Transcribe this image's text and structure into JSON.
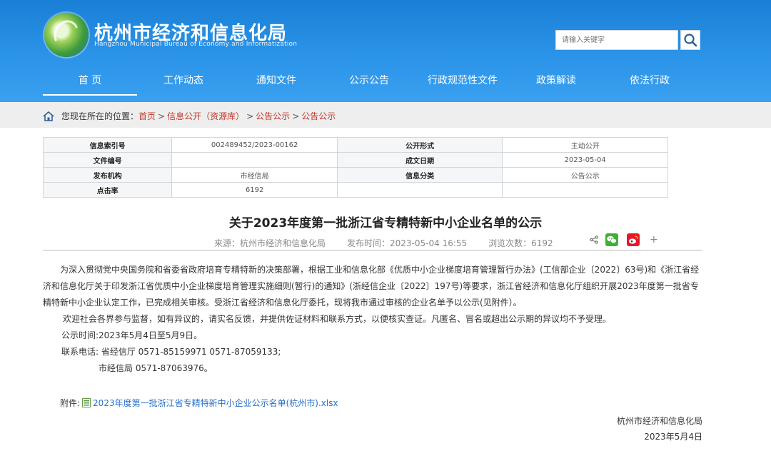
{
  "header": {
    "title": "杭州市经济和信息化局",
    "subtitle": "Hangzhou Municipal Bureau of Economy and Informatization",
    "search_placeholder": "请输入关键字"
  },
  "nav": [
    {
      "label": "首 页",
      "active": true
    },
    {
      "label": "工作动态"
    },
    {
      "label": "通知文件"
    },
    {
      "label": "公示公告"
    },
    {
      "label": "行政规范性文件"
    },
    {
      "label": "政策解读"
    },
    {
      "label": "依法行政"
    }
  ],
  "breadcrumb": {
    "prefix": "您现在所在的位置：",
    "items": [
      "首页",
      "信息公开（资源库）",
      "公告公示",
      "公告公示"
    ],
    "sep": ">"
  },
  "meta": {
    "rows": [
      [
        "信息索引号",
        "002489452/2023-00162",
        "公开形式",
        "主动公开"
      ],
      [
        "文件编号",
        "",
        "成文日期",
        "2023-05-04"
      ],
      [
        "发布机构",
        "市经信局",
        "信息分类",
        "公告公示"
      ],
      [
        "点击率",
        "6192",
        "",
        ""
      ]
    ]
  },
  "article": {
    "title": "关于2023年度第一批浙江省专精特新中小企业名单的公示",
    "source": "来源：杭州市经济和信息化局",
    "date": "发布时间：2023-05-04 16:55",
    "views": "浏览次数：6192",
    "paragraphs": [
      "为深入贯彻党中央国务院和省委省政府培育专精特新的决策部署，根据工业和信息化部《优质中小企业梯度培育管理暂行办法》(工信部企业〔2022〕63号)和《浙江省经济和信息化厅关于印发浙江省优质中小企业梯度培育管理实施细则(暂行)的通知》(浙经信企业〔2022〕197号)等要求，浙江省经济和信息化厅组织开展2023年度第一批省专精特新中小企业认定工作，已完成相关审核。受浙江省经济和信息化厅委托，现将我市通过审核的企业名单予以公示(见附件）。",
      "欢迎社会各界参与监督，如有异议的，请实名反馈，并提供佐证材料和联系方式，以便核实查证。凡匿名、冒名或超出公示期的异议均不予受理。",
      "公示时间:2023年5月4日至5月9日。",
      "联系电话: 省经信厅 0571-85159971 0571-87059133;",
      "市经信局 0571-87063976。"
    ],
    "attachment_label": "附件:",
    "attachment_name": "2023年度第一批浙江省专精特新中小企业公示名单(杭州市).xlsx",
    "signature": "杭州市经济和信息化局",
    "sign_date": "2023年5月4日"
  },
  "icons": {
    "home": "home-icon",
    "search": "search-icon",
    "share": "share-icon",
    "wechat": "wechat-icon",
    "weibo": "weibo-icon",
    "more": "plus-icon",
    "file": "excel-file-icon"
  },
  "colors": {
    "header_blue": "#1a7fd6",
    "link_red": "#c0392b",
    "link_blue": "#2a6fc9",
    "wechat_green": "#3eb135",
    "weibo_red": "#e6162d"
  }
}
